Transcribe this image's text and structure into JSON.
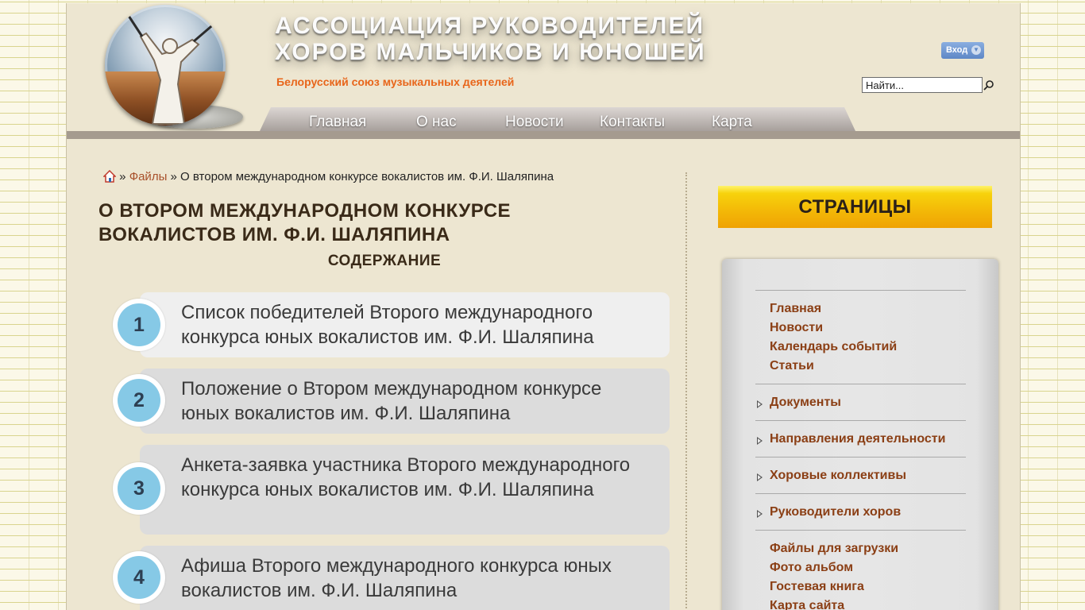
{
  "header": {
    "title_line1": "АССОЦИАЦИЯ РУКОВОДИТЕЛЕЙ",
    "title_line2": "ХОРОВ МАЛЬЧИКОВ И ЮНОШЕЙ",
    "subtitle": "Белорусский союз музыкальных деятелей",
    "login_label": "Вход",
    "search_value": "Найти..."
  },
  "nav": {
    "items": [
      "Главная",
      "О нас",
      "Новости",
      "Контакты",
      "Карта"
    ]
  },
  "breadcrumb": {
    "separator": "»",
    "files": "Файлы",
    "current": "О втором международном конкурсе вокалистов им. Ф.И. Шаляпина"
  },
  "main": {
    "title": "О ВТОРОМ МЕЖДУНАРОДНОМ КОНКУРСЕ ВОКАЛИСТОВ ИМ. Ф.И. ШАЛЯПИНА",
    "toc_heading": "СОДЕРЖАНИЕ",
    "toc": [
      {
        "num": "1",
        "text": "Список победителей Второго международного конкурса юных вокалистов им. Ф.И. Шаляпина"
      },
      {
        "num": "2",
        "text": "Положение о Втором международном конкурсе юных вокалистов им. Ф.И. Шаляпина"
      },
      {
        "num": "3",
        "text": "Анкета-заявка участника Второго международного конкурса юных вокалистов им. Ф.И. Шаляпина"
      },
      {
        "num": "4",
        "text": "Афиша Второго международного конкурса юных вокалистов им. Ф.И. Шаляпина"
      }
    ]
  },
  "sidebar": {
    "header": "СТРАНИЦЫ",
    "group1": [
      "Главная",
      "Новости",
      "Календарь событий",
      "Статьи"
    ],
    "expandable": [
      "Документы",
      "Направления деятельности",
      "Хоровые коллективы",
      "Руководители хоров"
    ],
    "group2": [
      "Файлы для загрузки",
      "Фото альбом",
      "Гостевая книга",
      "Карта сайта"
    ]
  },
  "colors": {
    "accent_orange": "#e8651a",
    "link_brown": "#8b3f15",
    "number_circle": "#86c9e6",
    "sidebar_header_gold": "#f3b807"
  },
  "icons": [
    "home-icon",
    "search-icon",
    "chevron-down-icon",
    "triangle-right-icon"
  ]
}
